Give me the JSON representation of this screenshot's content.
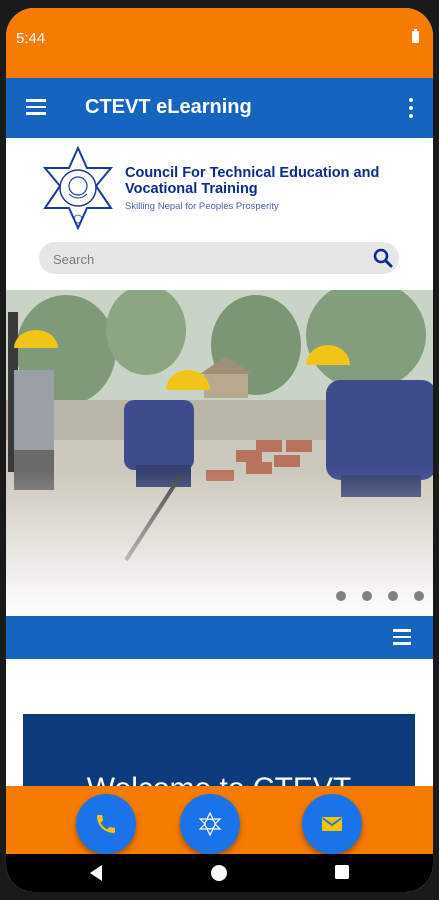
{
  "status_bar": {
    "time": "5:44",
    "battery_icon": "battery-icon"
  },
  "app_bar": {
    "title": "CTEVT eLearning",
    "menu_icon": "hamburger-menu-icon",
    "more_icon": "more-vert-icon"
  },
  "header": {
    "org_name": "Council For Technical Education and Vocational Training",
    "tagline": "Skilling Nepal for Peoples Prosperity",
    "search_placeholder": "Search"
  },
  "hero": {
    "slide_count": 4,
    "active_slide": 1
  },
  "welcome_text": "Welcome to CTEVT",
  "bottom_actions": [
    {
      "icon": "phone-icon"
    },
    {
      "icon": "ctevt-emblem-icon"
    },
    {
      "icon": "email-icon"
    }
  ],
  "colors": {
    "primary": "#1565c0",
    "accent": "#f57c00",
    "heading": "#0d2b8a",
    "banner": "#0d3a7a"
  }
}
